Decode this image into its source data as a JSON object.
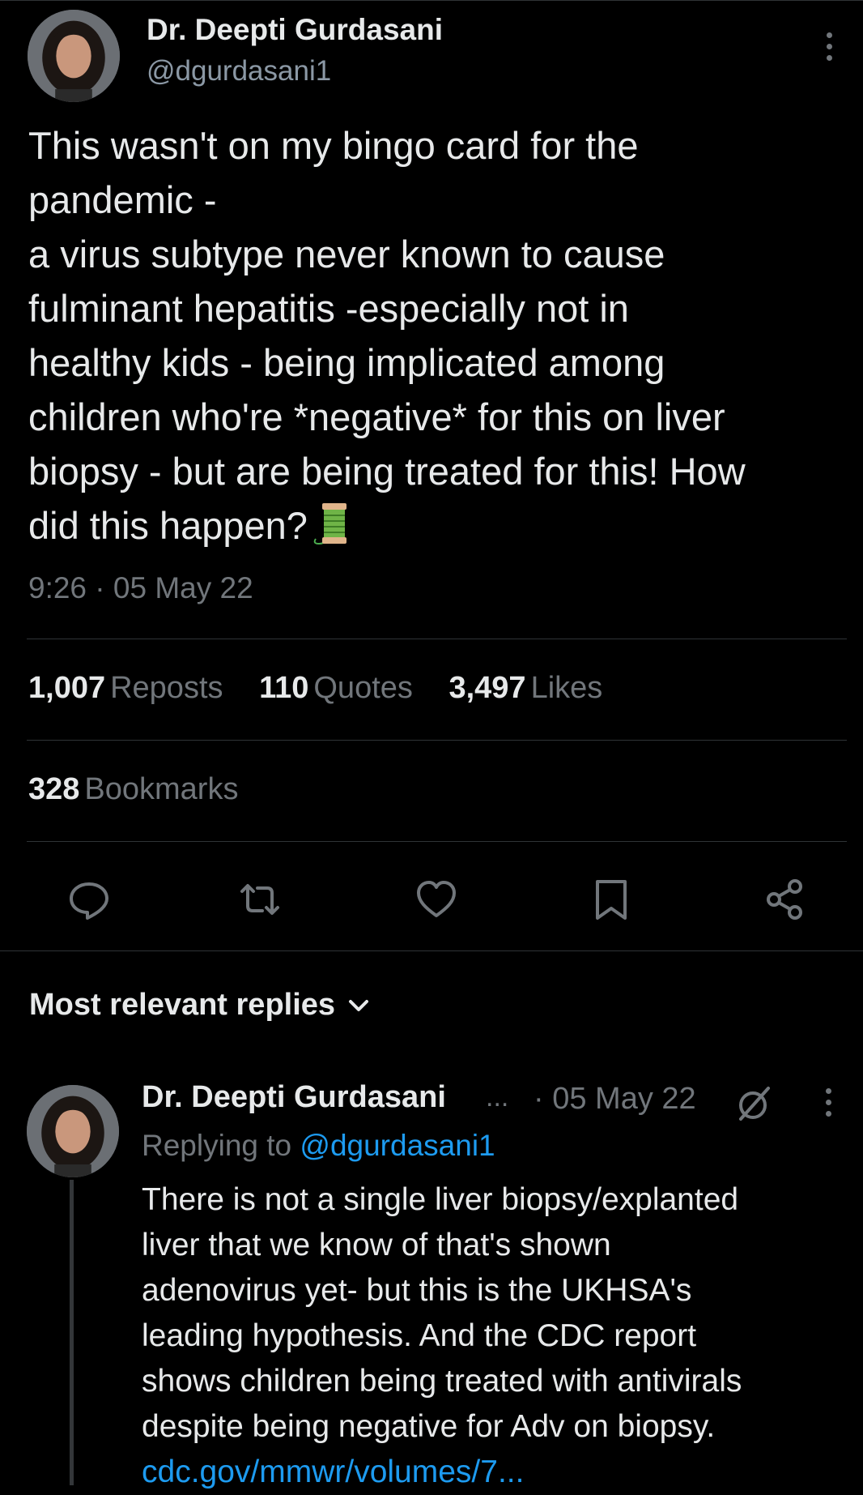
{
  "tweet": {
    "author_name": "Dr. Deepti Gurdasani",
    "author_handle": "@dgurdasani1",
    "text_lines": [
      "This wasn't on my bingo card for the",
      "pandemic -",
      "a virus subtype never known to cause",
      "fulminant hepatitis -especially not in",
      "healthy kids - being implicated among",
      "children who're *negative* for this on liver",
      "biopsy - but are being treated for this! How",
      "did this happen?"
    ],
    "emoji_icon": "thread-spool-emoji",
    "timestamp": "9:26 · 05 May 22",
    "stats": {
      "reposts_count": "1,007",
      "reposts_label": "Reposts",
      "quotes_count": "110",
      "quotes_label": "Quotes",
      "likes_count": "3,497",
      "likes_label": "Likes",
      "bookmarks_count": "328",
      "bookmarks_label": "Bookmarks"
    },
    "actions": [
      "reply-icon",
      "repost-icon",
      "like-icon",
      "bookmark-icon",
      "share-icon"
    ]
  },
  "replies_section": {
    "header": "Most relevant replies"
  },
  "reply": {
    "author_name": "Dr. Deepti Gurdasani",
    "ellipsis": "...",
    "date": "· 05 May 22",
    "replying_prefix": "Replying to",
    "replying_handle": "@dgurdasani1",
    "text_lines": [
      "There is not a single liver biopsy/explanted",
      "liver that we know of that's shown",
      "adenovirus yet- but this is the UKHSA's",
      "leading hypothesis. And the CDC report",
      "shows children being treated with antivirals",
      "despite being negative for Adv on biopsy."
    ],
    "link": "cdc.gov/mmwr/volumes/7..."
  },
  "colors": {
    "background": "#000000",
    "text": "#e7e9ea",
    "secondary": "#71767b",
    "accent": "#1d9bf0",
    "divider": "#2f3336"
  }
}
